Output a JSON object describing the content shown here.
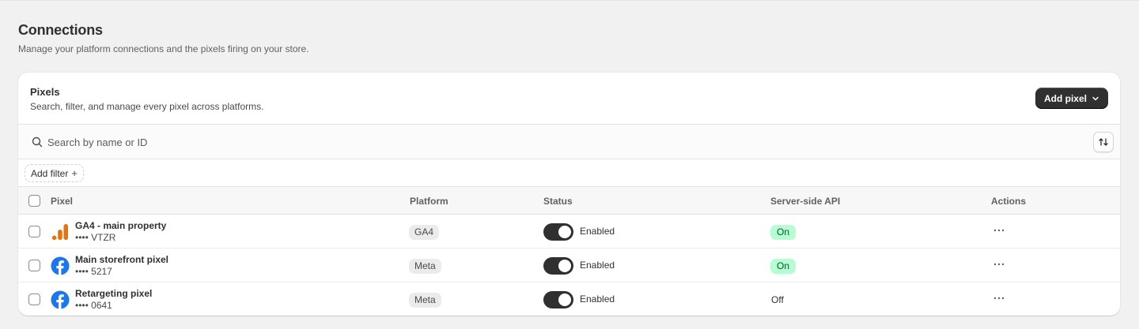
{
  "page": {
    "title": "Connections",
    "subtitle": "Manage your platform connections and the pixels firing on your store."
  },
  "card": {
    "title": "Pixels",
    "subtitle": "Search, filter, and manage every pixel across platforms.",
    "add_button_label": "Add pixel"
  },
  "search": {
    "placeholder": "Search by name or ID"
  },
  "filters": {
    "add_filter_label": "Add filter"
  },
  "table": {
    "columns": [
      "Pixel",
      "Platform",
      "Status",
      "Server-side API",
      "Actions"
    ],
    "rows": [
      {
        "name": "GA4 - main property",
        "id": "•••• VTZR",
        "icon": "google-analytics-icon",
        "platform": "GA4",
        "status": "Enabled",
        "server_side": "On",
        "server_side_on": true
      },
      {
        "name": "Main storefront pixel",
        "id": "•••• 5217",
        "icon": "facebook-icon",
        "platform": "Meta",
        "status": "Enabled",
        "server_side": "On",
        "server_side_on": true
      },
      {
        "name": "Retargeting pixel",
        "id": "•••• 0641",
        "icon": "facebook-icon",
        "platform": "Meta",
        "status": "Enabled",
        "server_side": "Off",
        "server_side_on": false
      }
    ]
  },
  "colors": {
    "primary_button": "#303030",
    "toggle_on": "#303030",
    "success_badge_bg": "#b4fed2",
    "success_badge_text": "#0c5132",
    "ga_orange": "#e8710a",
    "facebook_blue": "#1877f2"
  }
}
